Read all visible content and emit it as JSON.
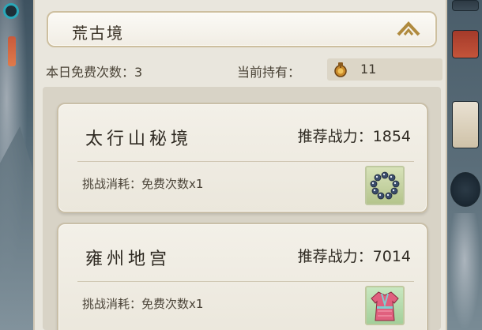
{
  "header": {
    "title": "荒古境"
  },
  "info": {
    "free_times_label": "本日免费次数：3",
    "holding_label": "当前持有：",
    "holding_count": "11",
    "holding_icon": "gourd-token-icon"
  },
  "dungeons": [
    {
      "name": "太行山秘境",
      "power": "推荐战力：1854",
      "cost": "挑战消耗：免费次数x1",
      "reward_icon": "bead-bracelet-icon"
    },
    {
      "name": "雍州地宫",
      "power": "推荐战力：7014",
      "cost": "挑战消耗：免费次数x1",
      "reward_icon": "pink-robe-icon"
    }
  ],
  "colors": {
    "panel_bg": "#e9e6dd",
    "card_bg": "#f3f0e8",
    "accent_gold": "#b08a3e",
    "text_dark": "#2f2a22"
  }
}
